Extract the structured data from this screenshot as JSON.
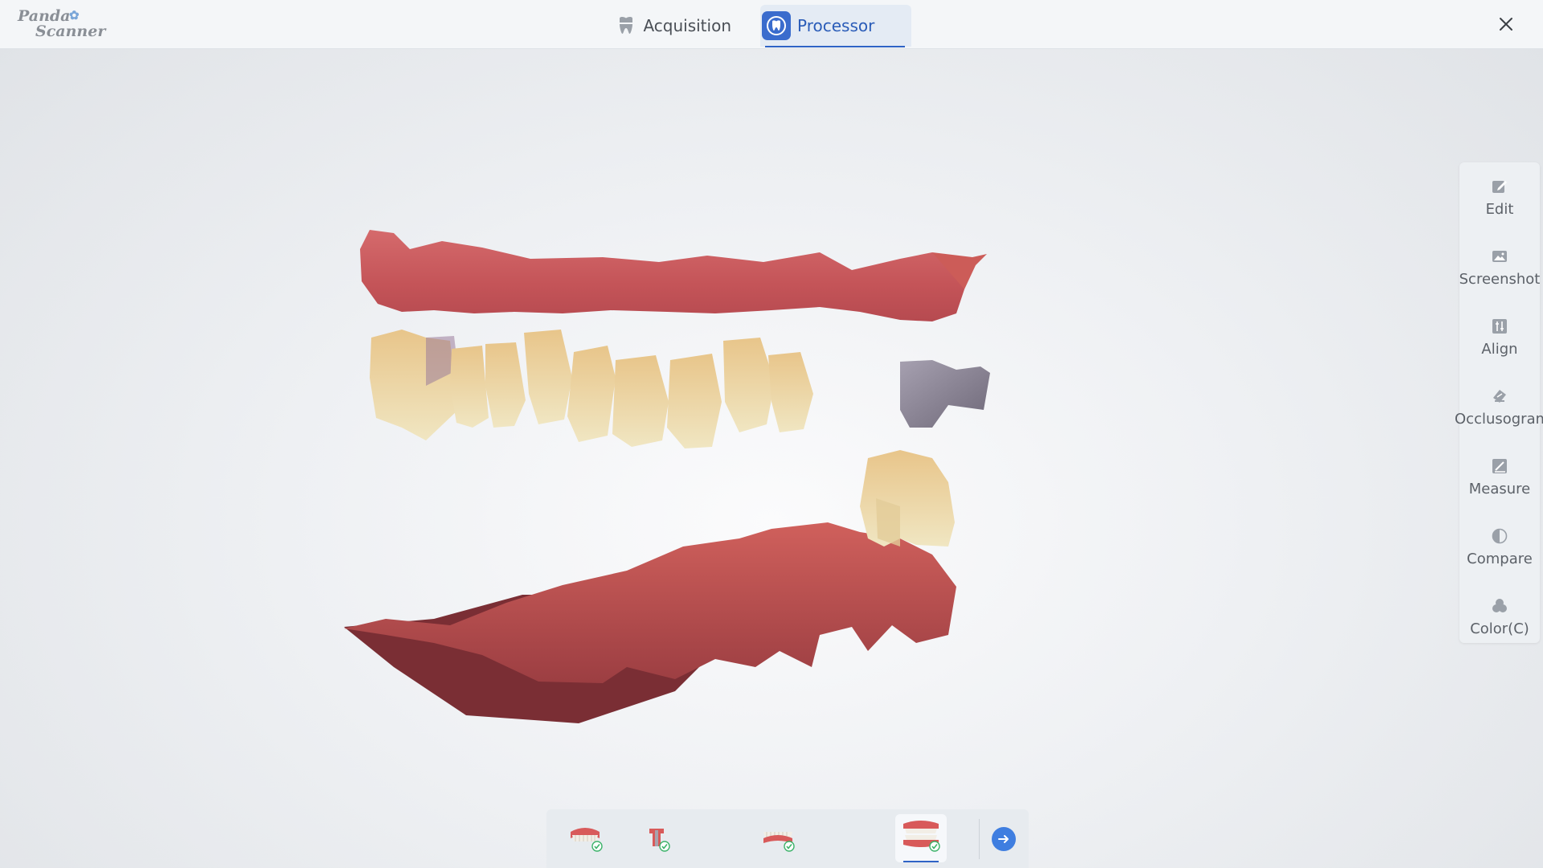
{
  "app": {
    "logo_line1": "Panda",
    "logo_line2": "Scanner"
  },
  "tabs": [
    {
      "label": "Acquisition",
      "icon": "tooth-icon",
      "active": false
    },
    {
      "label": "Processor",
      "icon": "processor-tooth-icon",
      "active": true
    }
  ],
  "window": {
    "close_icon": "close-icon"
  },
  "tools": [
    {
      "label": "Edit",
      "icon": "edit-icon"
    },
    {
      "label": "Screenshot",
      "icon": "image-icon"
    },
    {
      "label": "Align",
      "icon": "align-icon"
    },
    {
      "label": "Occlusogram",
      "icon": "occlusogram-icon"
    },
    {
      "label": "Measure",
      "icon": "measure-icon"
    },
    {
      "label": "Compare",
      "icon": "half-circle-icon"
    },
    {
      "label": "Color(C)",
      "icon": "palette-icon"
    }
  ],
  "dock": {
    "items": [
      {
        "name": "upper-jaw",
        "icon": "upper-jaw-check-icon",
        "done": true,
        "active": false
      },
      {
        "name": "abutment",
        "icon": "abutment-check-icon",
        "done": true,
        "active": false
      },
      {
        "name": "lower-jaw",
        "icon": "lower-jaw-check-icon",
        "done": true,
        "active": false
      },
      {
        "name": "bite",
        "icon": "bite-check-icon",
        "done": true,
        "active": true
      }
    ],
    "next_icon": "arrow-right-icon"
  },
  "colors": {
    "accent": "#2f63c6",
    "gum": "#c9585a",
    "tooth": "#e8d6a6",
    "check": "#3db36a"
  }
}
